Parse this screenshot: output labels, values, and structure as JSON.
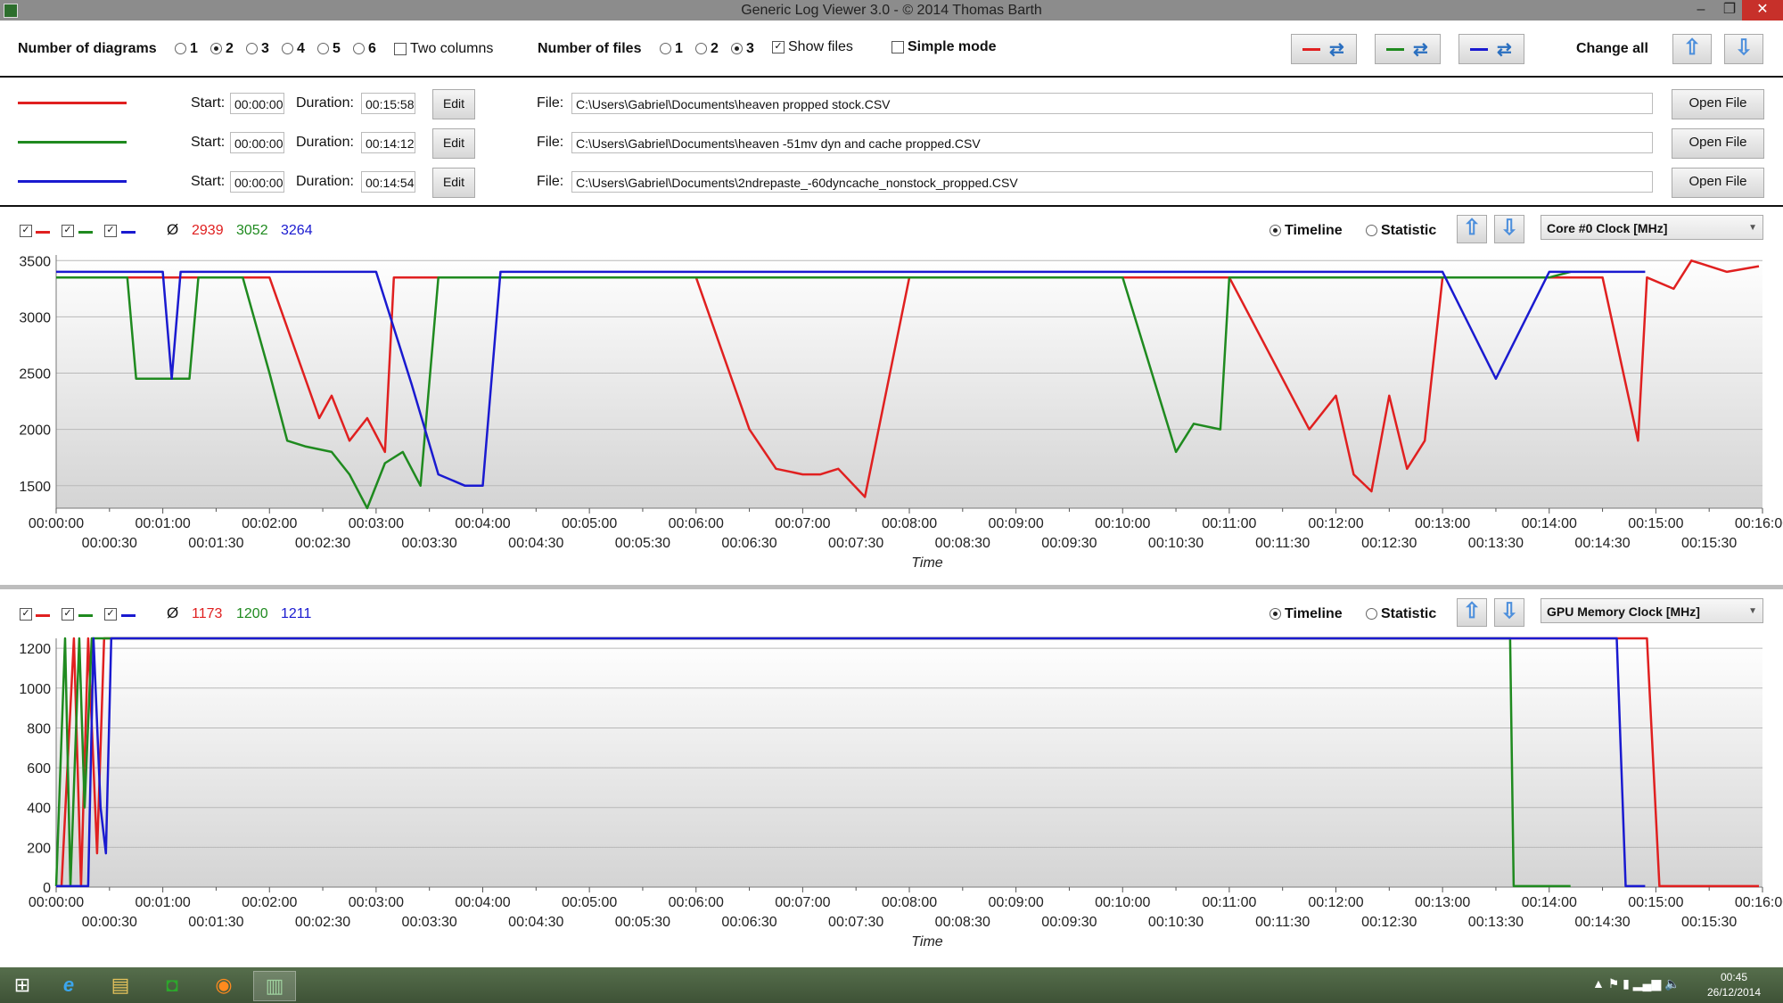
{
  "window": {
    "title": "Generic Log Viewer 3.0 - © 2014 Thomas Barth",
    "minimize": "–",
    "restore": "❐",
    "close": "✕"
  },
  "toolbar": {
    "num_diagrams_label": "Number of diagrams",
    "diagram_options": [
      "1",
      "2",
      "3",
      "4",
      "5",
      "6"
    ],
    "diagram_selected": "2",
    "two_columns_label": "Two columns",
    "two_columns_checked": false,
    "num_files_label": "Number of files",
    "file_options": [
      "1",
      "2",
      "3"
    ],
    "file_selected": "3",
    "show_files_label": "Show files",
    "show_files_checked": true,
    "simple_mode_label": "Simple mode",
    "simple_mode_checked": false,
    "change_all_label": "Change all",
    "refresh_glyph": "⇄",
    "up_glyph": "⇧",
    "down_glyph": "⇩"
  },
  "colors": {
    "red": "#e02020",
    "green": "#1f8a1f",
    "blue": "#1a1ad0"
  },
  "files": [
    {
      "color": "red",
      "start_label": "Start:",
      "start": "00:00:00",
      "duration_label": "Duration:",
      "duration": "00:15:58",
      "edit": "Edit",
      "file_label": "File:",
      "path": "C:\\Users\\Gabriel\\Documents\\heaven propped stock.CSV",
      "open": "Open File"
    },
    {
      "color": "green",
      "start_label": "Start:",
      "start": "00:00:00",
      "duration_label": "Duration:",
      "duration": "00:14:12",
      "edit": "Edit",
      "file_label": "File:",
      "path": "C:\\Users\\Gabriel\\Documents\\heaven -51mv dyn and cache propped.CSV",
      "open": "Open File"
    },
    {
      "color": "blue",
      "start_label": "Start:",
      "start": "00:00:00",
      "duration_label": "Duration:",
      "duration": "00:14:54",
      "edit": "Edit",
      "file_label": "File:",
      "path": "C:\\Users\\Gabriel\\Documents\\2ndrepaste_-60dyncache_nonstock_propped.CSV",
      "open": "Open File"
    }
  ],
  "panels": [
    {
      "avg_symbol": "Ø",
      "averages": [
        "2939",
        "3052",
        "3264"
      ],
      "timeline_label": "Timeline",
      "statistic_label": "Statistic",
      "metric": "Core #0 Clock [MHz]"
    },
    {
      "avg_symbol": "Ø",
      "averages": [
        "1173",
        "1200",
        "1211"
      ],
      "timeline_label": "Timeline",
      "statistic_label": "Statistic",
      "metric": "GPU Memory Clock [MHz]"
    }
  ],
  "chart_data": [
    {
      "type": "line",
      "title": "Core #0 Clock [MHz]",
      "xlabel": "Time",
      "ylabel": "",
      "ylim": [
        1300,
        3550
      ],
      "xlim_seconds": [
        0,
        960
      ],
      "yticks": [
        1500,
        2000,
        2500,
        3000,
        3500
      ],
      "xticks_top": [
        "00:00:00",
        "00:01:00",
        "00:02:00",
        "00:03:00",
        "00:04:00",
        "00:05:00",
        "00:06:00",
        "00:07:00",
        "00:08:00",
        "00:09:00",
        "00:10:00",
        "00:11:00",
        "00:12:00",
        "00:13:00",
        "00:14:00",
        "00:15:00",
        "00:16:00"
      ],
      "xticks_bottom": [
        "00:00:30",
        "00:01:30",
        "00:02:30",
        "00:03:30",
        "00:04:30",
        "00:05:30",
        "00:06:30",
        "00:07:30",
        "00:08:30",
        "00:09:30",
        "00:10:30",
        "00:11:30",
        "00:12:30",
        "00:13:30",
        "00:14:30",
        "00:15:30"
      ],
      "grid": true,
      "series": [
        {
          "color": "red",
          "x": [
            "00:00:00",
            "00:02:00",
            "00:02:28",
            "00:02:35",
            "00:02:45",
            "00:02:55",
            "00:03:05",
            "00:03:10",
            "00:03:20",
            "00:03:30",
            "00:04:00",
            "00:05:00",
            "00:06:00",
            "00:06:30",
            "00:06:45",
            "00:07:00",
            "00:07:10",
            "00:07:20",
            "00:07:35",
            "00:08:00",
            "00:09:00",
            "00:10:00",
            "00:11:00",
            "00:11:35",
            "00:11:45",
            "00:12:00",
            "00:12:10",
            "00:12:20",
            "00:12:30",
            "00:12:40",
            "00:12:50",
            "00:13:00",
            "00:13:30",
            "00:14:00",
            "00:14:30",
            "00:14:50",
            "00:14:55",
            "00:15:10",
            "00:15:20",
            "00:15:40",
            "00:15:58"
          ],
          "y": [
            3350,
            3350,
            2100,
            2300,
            1900,
            2100,
            1800,
            3350,
            3350,
            3350,
            3350,
            3350,
            3350,
            2000,
            1650,
            1600,
            1600,
            1650,
            1400,
            3350,
            3350,
            3350,
            3350,
            2300,
            2000,
            2300,
            1600,
            1450,
            2300,
            1650,
            1900,
            3350,
            3350,
            3350,
            3350,
            1900,
            3350,
            3250,
            3500,
            3400,
            3450
          ]
        },
        {
          "color": "green",
          "x": [
            "00:00:00",
            "00:00:40",
            "00:00:45",
            "00:01:15",
            "00:01:20",
            "00:01:45",
            "00:02:00",
            "00:02:10",
            "00:02:20",
            "00:02:35",
            "00:02:45",
            "00:02:55",
            "00:03:05",
            "00:03:15",
            "00:03:25",
            "00:03:35",
            "00:03:45",
            "00:04:00",
            "00:05:00",
            "00:06:00",
            "00:07:00",
            "00:08:00",
            "00:09:00",
            "00:10:00",
            "00:10:30",
            "00:10:40",
            "00:10:55",
            "00:11:00",
            "00:12:00",
            "00:13:00",
            "00:14:00",
            "00:14:12"
          ],
          "y": [
            3350,
            3350,
            2450,
            2450,
            3350,
            3350,
            2500,
            1900,
            1850,
            1800,
            1600,
            1300,
            1700,
            1800,
            1500,
            3350,
            3350,
            3350,
            3350,
            3350,
            3350,
            3350,
            3350,
            3350,
            1800,
            2050,
            2000,
            3350,
            3350,
            3350,
            3350,
            3400
          ]
        },
        {
          "color": "blue",
          "x": [
            "00:00:00",
            "00:01:00",
            "00:01:05",
            "00:01:10",
            "00:01:20",
            "00:02:00",
            "00:03:00",
            "00:03:20",
            "00:03:35",
            "00:03:50",
            "00:04:00",
            "00:04:10",
            "00:05:00",
            "00:06:00",
            "00:07:00",
            "00:08:00",
            "00:09:00",
            "00:10:00",
            "00:11:00",
            "00:12:00",
            "00:13:00",
            "00:13:30",
            "00:14:00",
            "00:14:30",
            "00:14:54"
          ],
          "y": [
            3400,
            3400,
            2450,
            3400,
            3400,
            3400,
            3400,
            2400,
            1600,
            1500,
            1500,
            3400,
            3400,
            3400,
            3400,
            3400,
            3400,
            3400,
            3400,
            3400,
            3400,
            2450,
            3400,
            3400,
            3400
          ]
        }
      ]
    },
    {
      "type": "line",
      "title": "GPU Memory Clock [MHz]",
      "xlabel": "Time",
      "ylabel": "",
      "ylim": [
        0,
        1250
      ],
      "xlim_seconds": [
        0,
        960
      ],
      "yticks": [
        0,
        200,
        400,
        600,
        800,
        1000,
        1200
      ],
      "xticks_top": [
        "00:00:00",
        "00:01:00",
        "00:02:00",
        "00:03:00",
        "00:04:00",
        "00:05:00",
        "00:06:00",
        "00:07:00",
        "00:08:00",
        "00:09:00",
        "00:10:00",
        "00:11:00",
        "00:12:00",
        "00:13:00",
        "00:14:00",
        "00:15:00",
        "00:16:00"
      ],
      "xticks_bottom": [
        "00:00:30",
        "00:01:30",
        "00:02:30",
        "00:03:30",
        "00:04:30",
        "00:05:30",
        "00:06:30",
        "00:07:30",
        "00:08:30",
        "00:09:30",
        "00:10:30",
        "00:11:30",
        "00:12:30",
        "00:13:30",
        "00:14:30",
        "00:15:30"
      ],
      "grid": true,
      "series": [
        {
          "color": "red",
          "x": [
            "00:00:00",
            "00:00:03",
            "00:00:10",
            "00:00:14",
            "00:00:18",
            "00:00:23",
            "00:00:27",
            "00:00:30",
            "00:14:55",
            "00:15:02",
            "00:15:58"
          ],
          "y": [
            5,
            5,
            1250,
            5,
            1250,
            170,
            1250,
            1250,
            1250,
            5,
            5
          ]
        },
        {
          "color": "green",
          "x": [
            "00:00:00",
            "00:00:05",
            "00:00:08",
            "00:00:13",
            "00:00:16",
            "00:00:20",
            "00:00:25",
            "00:13:38",
            "00:13:40",
            "00:14:12"
          ],
          "y": [
            5,
            1250,
            5,
            1250,
            400,
            1250,
            1250,
            1250,
            5,
            5
          ]
        },
        {
          "color": "blue",
          "x": [
            "00:00:00",
            "00:00:18",
            "00:00:21",
            "00:00:25",
            "00:00:28",
            "00:00:31",
            "00:14:38",
            "00:14:43",
            "00:14:54"
          ],
          "y": [
            5,
            5,
            1250,
            400,
            170,
            1250,
            1250,
            5,
            5
          ]
        }
      ]
    }
  ],
  "taskbar": {
    "start": "⊞",
    "apps": [
      {
        "name": "ie",
        "glyph": "e"
      },
      {
        "name": "explorer",
        "glyph": "▤"
      },
      {
        "name": "store",
        "glyph": "◘"
      },
      {
        "name": "firefox",
        "glyph": "◉"
      },
      {
        "name": "logviewer",
        "glyph": "▥"
      }
    ],
    "tray": "▲  ⚑  ▮  ▂▄▆  🔈",
    "time": "00:45",
    "date": "26/12/2014"
  }
}
